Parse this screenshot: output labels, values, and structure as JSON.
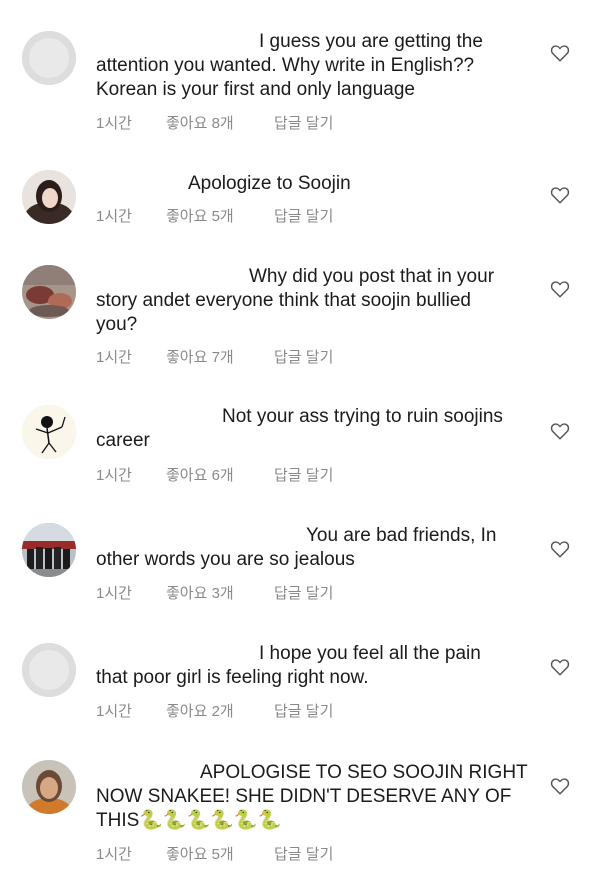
{
  "comments": [
    {
      "avatar_icon": "default-avatar-icon",
      "lines": [
        "I guess you are getting the",
        "attention you wanted. Why write in English??",
        "Korean is your first and only language"
      ],
      "time": "1시간",
      "likes": "좋아요 8개",
      "reply": "답글 달기"
    },
    {
      "avatar_icon": "user-photo-avatar",
      "lines": [
        "Apologize to Soojin"
      ],
      "time": "1시간",
      "likes": "좋아요 5개",
      "reply": "답글 달기"
    },
    {
      "avatar_icon": "user-photo-avatar",
      "lines": [
        "Why did you post that in your",
        "story andet everyone think that soojin bullied",
        "you?"
      ],
      "time": "1시간",
      "likes": "좋아요 7개",
      "reply": "답글 달기"
    },
    {
      "avatar_icon": "stick-figure-avatar",
      "lines": [
        "Not your ass trying to ruin soojins",
        "career"
      ],
      "time": "1시간",
      "likes": "좋아요 6개",
      "reply": "답글 달기"
    },
    {
      "avatar_icon": "group-photo-avatar",
      "lines": [
        "You are bad friends, In",
        "other words you are so jealous"
      ],
      "time": "1시간",
      "likes": "좋아요 3개",
      "reply": "답글 달기"
    },
    {
      "avatar_icon": "default-avatar-icon",
      "lines": [
        "I hope you feel all the pain",
        "that poor girl is feeling right now."
      ],
      "time": "1시간",
      "likes": "좋아요 2개",
      "reply": "답글 달기"
    },
    {
      "avatar_icon": "user-photo-avatar",
      "lines": [
        "APOLOGISE TO SEO SOOJIN RIGHT",
        "NOW SNAKEE! SHE DIDN'T DESERVE ANY OF",
        "THIS🐍🐍🐍🐍🐍🐍"
      ],
      "time": "1시간",
      "likes": "좋아요 5개",
      "reply": "답글 달기"
    }
  ],
  "colors": {
    "meta_text": "#8a8a8a",
    "heart_outline": "#555555",
    "default_avatar_bg": "#dcdcdc"
  }
}
